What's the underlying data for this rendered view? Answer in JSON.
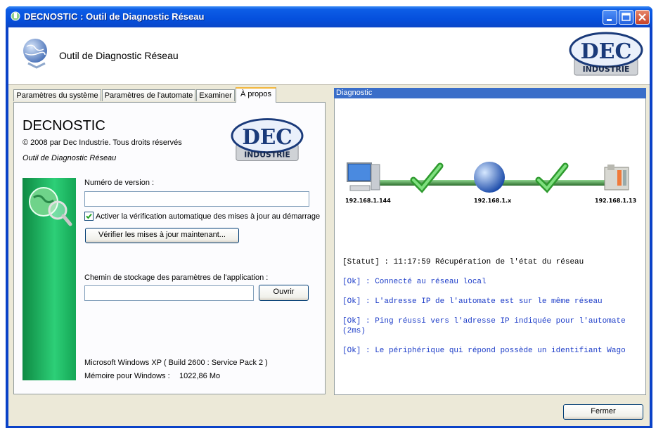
{
  "window": {
    "title": "DECNOSTIC : Outil de Diagnostic Réseau"
  },
  "header": {
    "title": "Outil de Diagnostic Réseau",
    "logo_top": "DEC",
    "logo_bottom": "INDUSTRIE"
  },
  "tabs": [
    {
      "label": "Paramètres du système"
    },
    {
      "label": "Paramètres de l'automate"
    },
    {
      "label": "Examiner"
    },
    {
      "label": "À propos"
    }
  ],
  "about": {
    "app_name": "DECNOSTIC",
    "copyright": "© 2008 par Dec Industrie. Tous droits réservés",
    "subtitle": "Outil de Diagnostic Réseau",
    "version_label": "Numéro de version :",
    "version_value": "",
    "auto_update_label": "Activer la vérification automatique des mises à jour au démarrage",
    "auto_update_checked": true,
    "check_updates_button": "Vérifier les mises à jour maintenant...",
    "storage_label": "Chemin de stockage des paramètres de l'application :",
    "storage_value": "",
    "open_button": "Ouvrir",
    "os_info": "Microsoft Windows XP ( Build 2600 : Service Pack 2 )",
    "memory_label": "Mémoire pour Windows :",
    "memory_value": "1022,86 Mo"
  },
  "diagnostic": {
    "title": "Diagnostic",
    "pc_ip": "192.168.1.144",
    "gateway_ip": "192.168.1.x",
    "plc_ip": "192.168.1.13",
    "log": [
      {
        "tag": "[Statut]",
        "text": "  : 11:17:59 Récupération de l'état du réseau",
        "kind": "status"
      },
      {
        "tag": "[Ok]",
        "text": "  : Connecté au réseau local",
        "kind": "ok"
      },
      {
        "tag": "[Ok]",
        "text": "  : L'adresse IP de l'automate est sur le même réseau",
        "kind": "ok"
      },
      {
        "tag": "[Ok]",
        "text": "  : Ping réussi vers l'adresse IP indiquée pour l'automate (2ms)",
        "kind": "ok"
      },
      {
        "tag": "[Ok]",
        "text": "  : Le périphérique qui répond possède un identifiant Wago",
        "kind": "ok"
      }
    ]
  },
  "footer": {
    "close_button": "Fermer"
  },
  "colors": {
    "accent": "#0a42c8",
    "ok_text": "#1c3cc8",
    "link_line": "#2e8b3c",
    "strip": "#1fae5c"
  }
}
